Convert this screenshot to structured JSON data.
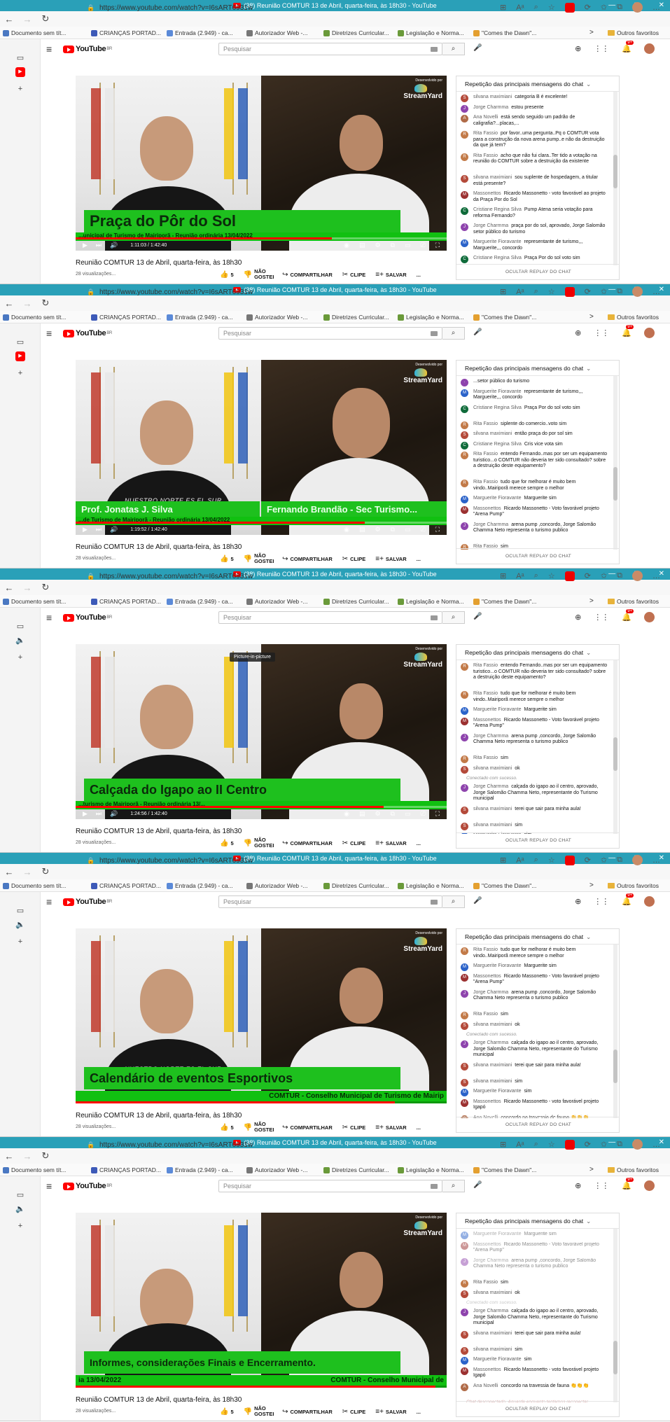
{
  "browser": {
    "title": "(38) Reunião COMTUR 13 de Abril, quarta-feira, às 18h30 - YouTube",
    "url": "https://www.youtube.com/watch?v=I6sART6931w",
    "bookmarks": [
      "Documento sem tít...",
      "CRIANÇAS PORTAD...",
      "Entrada (2.949) - ca...",
      "Autorizador Web -...",
      "Diretrizes Curricular...",
      "Legislação e Norma...",
      "\"Comes the Dawn\"..."
    ],
    "bookmarks_more": ">",
    "other_favorites": "Outros favoritos"
  },
  "youtube": {
    "logo": "YouTube",
    "logo_region": "BR",
    "search_placeholder": "Pesquisar",
    "notification_badge": "9+",
    "video_title": "Reunião COMTUR 13 de Abril, quarta-feira, às 18h30",
    "views": "28 visualizações...",
    "likes": "5",
    "dislike": "NÃO GOSTEI",
    "share": "COMPARTILHAR",
    "clip": "CLIPE",
    "save": "SALVAR",
    "more": "...",
    "chat_header": "Repetição das principais mensagens do chat",
    "chat_footer": "OCULTAR REPLAY DO CHAT",
    "streamyard_small": "Desenvolvido por",
    "streamyard": "StreamYard",
    "pip_label": "Picture-in-picture"
  },
  "colors": {
    "titlebar": "#2aa0b8",
    "lower_third": "#1ec01e",
    "youtube_red": "#ff0000"
  },
  "frames": [
    {
      "banner": "Praça do Pôr do Sol",
      "ticker": "...unicipal de Turismo de Mairiporã - Reunião ordinária 13/04/2022",
      "time": "1:11:03 / 1:42:40",
      "progress": 0.69,
      "thumb_top": 0.45,
      "messages": [
        {
          "a": "silvana maximiani",
          "t": "categoria B é excelente!",
          "c": "#b44a3a"
        },
        {
          "a": "Jorge Charmma",
          "t": "estou presente",
          "c": "#8e44ad"
        },
        {
          "a": "Ana Novelli",
          "t": "está sendo seguido um padrão de caligrafia?...placas,...",
          "c": "#b06b48"
        },
        {
          "a": "Rita Fassio",
          "t": "por favor..uma pergunta..Pq o COMTUR vota para a construção da nova arena pump..e não da destruição da que já tem?",
          "c": "#c27a48"
        },
        {
          "a": "Rita Fassio",
          "t": "acho que não fui clara..Ter tido a votação na reunião do COMTUR sobre a destruição da existente",
          "c": "#c27a48"
        },
        {
          "a": "silvana maximiani",
          "t": "sou suplente de hospedagem, a titular está presente?",
          "c": "#b44a3a"
        },
        {
          "a": "Massonettos",
          "t": "Ricardo Massonetto - voto favorável ao projeto da Praça Por do Sol",
          "c": "#9b3030"
        },
        {
          "a": "Cristiane Regina Silva",
          "t": "Pump Atena seria votação para reforma Fernando?",
          "c": "#0f6b3a"
        },
        {
          "a": "Jorge Charmma",
          "t": "praça por do sol, aprovado, Jorge Salomão setor público do turismo",
          "c": "#8e44ad"
        },
        {
          "a": "Marguerite Fioravante",
          "t": "representante de turismo,,, Marguerite,,, concordo",
          "c": "#2a62c9"
        },
        {
          "a": "Cristiane Regina Silva",
          "t": "Praça Por do sol voto sim",
          "c": "#0f6b3a"
        },
        {
          "a": "Rita Fassio",
          "t": "siplente do comercio..voto sim",
          "c": "#c27a48"
        },
        {
          "a": "silvana maximiani",
          "t": "então praça do por sol sim",
          "c": "#b44a3a"
        }
      ]
    },
    {
      "name_left": "Prof. Jonatas J. Silva",
      "name_right": "Fernando Brandão - Sec Turismo...",
      "ticker": "...de Turismo de Mairiporã - Reunião ordinária 13/04/2022",
      "time": "1:19:52 / 1:42:40",
      "progress": 0.78,
      "thumb_top": 0.65,
      "messages": [
        {
          "a": "",
          "t": "...setor público do turismo",
          "c": "#8e44ad"
        },
        {
          "a": "Marguerite Fioravante",
          "t": "representante de turismo,,, Marguerite,,, concordo",
          "c": "#2a62c9"
        },
        {
          "a": "Cristiane Regina Silva",
          "t": "Praça Por do sol voto sim",
          "c": "#0f6b3a"
        },
        {
          "a": "Rita Fassio",
          "t": "siplente do comercio..voto sim",
          "c": "#c27a48"
        },
        {
          "a": "silvana maximiani",
          "t": "então praça do por sol sim",
          "c": "#b44a3a"
        },
        {
          "a": "Cristiane Regina Silva",
          "t": "Cris vice vota sim",
          "c": "#0f6b3a"
        },
        {
          "a": "Rita Fassio",
          "t": "entendo Fernando..mas por ser um equipamento turistico...o COMTUR não deveria ter sido consultado? sobre a destruição deste equipamento?",
          "c": "#c27a48"
        },
        {
          "a": "Rita Fassio",
          "t": "tudo que for melhorar é muito bem vindo..Mairiporã merece sempre o melhor",
          "c": "#c27a48"
        },
        {
          "a": "Marguerite Fioravante",
          "t": "Marguerite sim",
          "c": "#2a62c9"
        },
        {
          "a": "Massonettos",
          "t": "Ricardo Massonetto - Voto favorável projeto \"Arena Pump\"",
          "c": "#9b3030"
        },
        {
          "a": "Jorge Charmma",
          "t": "arena pump ,concordo, Jorge Salomão Chamma Neto representa o turismo publico",
          "c": "#8e44ad"
        },
        {
          "a": "Rita Fassio",
          "t": "sim",
          "c": "#c27a48"
        },
        {
          "a": "silvana maximiani",
          "t": "ok",
          "c": "#b44a3a"
        }
      ],
      "system": [
        "Conectado com sucesso."
      ]
    },
    {
      "banner": "Calçada do Igapo ao II Centro",
      "ticker": "...turismo de Mairiporã - Reunião ordinária 13/...",
      "time": "1:24:56 / 1:42:40",
      "progress": 0.83,
      "thumb_top": 0.55,
      "pip": true,
      "messages": [
        {
          "a": "Rita Fassio",
          "t": "entendo Fernando..mas por ser um equipamento turistico...o COMTUR não deveria ter sido consultado? sobre a destruição deste equipamento?",
          "c": "#c27a48"
        },
        {
          "a": "Rita Fassio",
          "t": "tudo que for melhorar é muito bem vindo..Mairiporã merece sempre o melhor",
          "c": "#c27a48"
        },
        {
          "a": "Marguerite Fioravante",
          "t": "Marguerite sim",
          "c": "#2a62c9"
        },
        {
          "a": "Massonettos",
          "t": "Ricardo Massonetto - Voto favorável projeto \"Arena Pump\"",
          "c": "#9b3030"
        },
        {
          "a": "Jorge Charmma",
          "t": "arena pump ,concordo, Jorge Salomão Chamma Neto representa o turismo publico",
          "c": "#8e44ad"
        },
        {
          "a": "Rita Fassio",
          "t": "sim",
          "c": "#c27a48"
        },
        {
          "a": "silvana maximiani",
          "t": "ok",
          "c": "#b44a3a"
        },
        {
          "a": "Jorge Charmma",
          "t": "calçada do igapo ao il centro, aprovado, Jorge Salomão Chamma Neto, representante do Turismo municipal",
          "c": "#8e44ad"
        },
        {
          "a": "silvana maximiani",
          "t": "terei que sair para minha aula!",
          "c": "#b44a3a"
        },
        {
          "a": "silvana maximiani",
          "t": "sim",
          "c": "#b44a3a"
        },
        {
          "a": "Marguerite Fioravante",
          "t": "sim",
          "c": "#2a62c9"
        },
        {
          "a": "Massonettos",
          "t": "Ricardo Massonetto - voto favorável projeto Igapó",
          "c": "#9b3030"
        }
      ],
      "system": [
        "Conectado com sucesso."
      ]
    },
    {
      "banner": "Calendário de eventos Esportivos",
      "ticker": "COMTUR - Conselho Municipal de Turismo de Mairip",
      "progress": 0.86,
      "thumb_top": 0.75,
      "no_controls": true,
      "messages": [
        {
          "a": "Rita Fassio",
          "t": "tudo que for melhorar é muito bem vindo..Mairiporã merece sempre o melhor",
          "c": "#c27a48"
        },
        {
          "a": "Marguerite Fioravante",
          "t": "Marguerite sim",
          "c": "#2a62c9"
        },
        {
          "a": "Massonettos",
          "t": "Ricardo Massonetto - Voto favorável projeto \"Arena Pump\"",
          "c": "#9b3030"
        },
        {
          "a": "Jorge Charmma",
          "t": "arena pump ,concordo, Jorge Salomão Chamma Neto representa o turismo publico",
          "c": "#8e44ad"
        },
        {
          "a": "Rita Fassio",
          "t": "sim",
          "c": "#c27a48"
        },
        {
          "a": "silvana maximiani",
          "t": "ok",
          "c": "#b44a3a"
        },
        {
          "a": "Jorge Charmma",
          "t": "calçada do igapo ao il centro, aprovado, Jorge Salomão Chamma Neto, representante do Turismo municipal",
          "c": "#8e44ad"
        },
        {
          "a": "silvana maximiani",
          "t": "terei que sair para minha aula!",
          "c": "#b44a3a"
        },
        {
          "a": "silvana maximiani",
          "t": "sim",
          "c": "#b44a3a"
        },
        {
          "a": "Marguerite Fioravante",
          "t": "sim",
          "c": "#2a62c9"
        },
        {
          "a": "Massonettos",
          "t": "Ricardo Massonetto - voto favorável projeto Igapó",
          "c": "#9b3030"
        },
        {
          "a": "Ana Novelli",
          "t": "concordo na travessia de fauna 👏👏👏",
          "c": "#b06b48"
        }
      ],
      "system": [
        "Conectado com sucesso."
      ]
    },
    {
      "banner": "Informes, considerações Finais e Encerramento.",
      "ticker_left": "ia 13/04/2022",
      "ticker": "COMTUR - Conselho Municipal de",
      "progress": 0.97,
      "thumb_top": 0.8,
      "faded": true,
      "no_controls": true,
      "messages": [
        {
          "a": "Marguerite Fioravante",
          "t": "Marguerite sim",
          "c": "#2a62c9"
        },
        {
          "a": "Massonettos",
          "t": "Ricardo Massonetto - Voto favorável projeto \"Arena Pump\"",
          "c": "#9b3030"
        },
        {
          "a": "Jorge Charmma",
          "t": "arena pump ,concordo, Jorge Salomão Chamma Neto representa o turismo publico",
          "c": "#8e44ad"
        },
        {
          "a": "Rita Fassio",
          "t": "sim",
          "c": "#c27a48"
        },
        {
          "a": "silvana maximiani",
          "t": "ok",
          "c": "#b44a3a"
        },
        {
          "a": "Jorge Charmma",
          "t": "calçada do igapo ao il centro, aprovado, Jorge Salomão Chamma Neto, representante do Turismo municipal",
          "c": "#8e44ad"
        },
        {
          "a": "silvana maximiani",
          "t": "terei que sair para minha aula!",
          "c": "#b44a3a"
        },
        {
          "a": "silvana maximiani",
          "t": "sim",
          "c": "#b44a3a"
        },
        {
          "a": "Marguerite Fioravante",
          "t": "sim",
          "c": "#2a62c9"
        },
        {
          "a": "Massonettos",
          "t": "Ricardo Massonetto - voto favorável projeto Igapó",
          "c": "#9b3030"
        },
        {
          "a": "Ana Novelli",
          "t": "concordo na travessia de fauna 👏👏👏",
          "c": "#b06b48"
        }
      ],
      "system": [
        "Conectado com sucesso.",
        "Chat desconectado. Aguarde enquanto tentamos reconectar.",
        "Chat desconectado. Aguarde enquanto tentamos reconectar."
      ]
    }
  ]
}
